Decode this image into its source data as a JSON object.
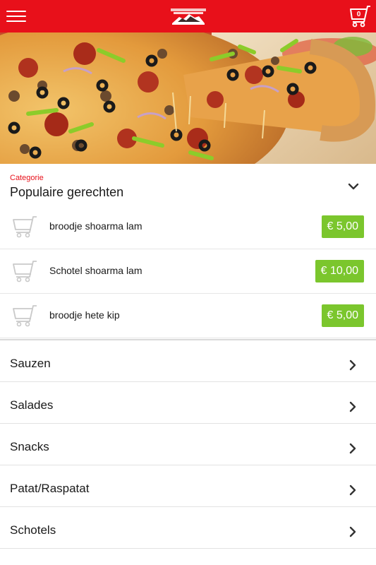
{
  "header": {
    "menu_icon": "hamburger-menu-icon",
    "logo_icon": "restaurant-logo",
    "cart_icon": "shopping-cart-icon",
    "cart_count": "0",
    "bar_color": "#e8101a"
  },
  "hero": {
    "image": "pizza-photo"
  },
  "category": {
    "caption": "Categorie",
    "title": "Populaire gerechten",
    "chevron_icon": "chevron-down-icon",
    "caption_color": "#e8101a"
  },
  "dishes": [
    {
      "name": "broodje shoarma lam",
      "price": "€ 5,00",
      "icon": "cart-icon"
    },
    {
      "name": "Schotel shoarma lam",
      "price": "€ 10,00",
      "icon": "cart-icon"
    },
    {
      "name": "broodje hete kip",
      "price": "€ 5,00",
      "icon": "cart-icon"
    }
  ],
  "price_color": "#7bc62d",
  "categories": [
    {
      "label": "Sauzen",
      "icon": "chevron-right-icon"
    },
    {
      "label": "Salades",
      "icon": "chevron-right-icon"
    },
    {
      "label": "Snacks",
      "icon": "chevron-right-icon"
    },
    {
      "label": "Patat/Raspatat",
      "icon": "chevron-right-icon"
    },
    {
      "label": "Schotels",
      "icon": "chevron-right-icon"
    }
  ]
}
